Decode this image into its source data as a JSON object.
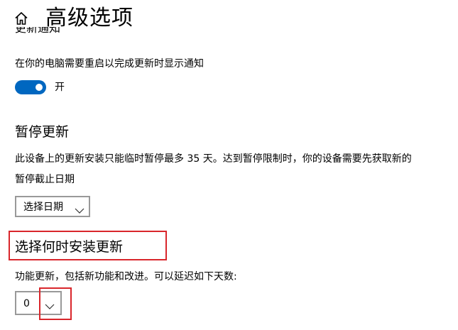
{
  "header": {
    "title": "高级选项",
    "home_icon": "home-icon"
  },
  "notify_section": {
    "heading_partial": "更新通知",
    "description": "在你的电脑需要重启以完成更新时显示通知",
    "toggle_state_label": "开",
    "toggle_on": true
  },
  "pause_section": {
    "heading": "暂停更新",
    "description_line1": "此设备上的更新安装只能临时暂停最多 35 天。达到暂停限制时，你的设备需要先获取新的",
    "description_line2": "暂停截止日期",
    "date_dropdown_label": "选择日期"
  },
  "install_section": {
    "heading": "选择何时安装更新",
    "description": "功能更新，包括新功能和改进。可以延迟如下天数:",
    "days_value": "0"
  },
  "colors": {
    "accent": "#0067c0",
    "highlight": "#d9262b",
    "border": "#999999"
  }
}
